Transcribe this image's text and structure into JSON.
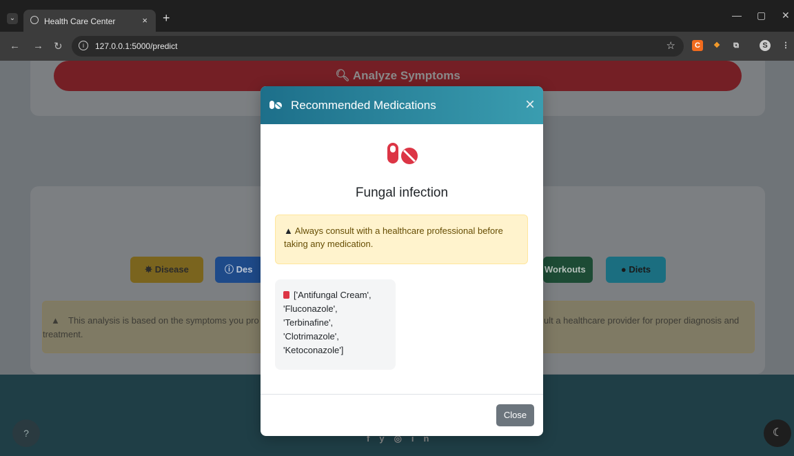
{
  "browser": {
    "tab_title": "Health Care Center",
    "tab_close": "×",
    "new_tab": "+",
    "url": "127.0.0.1:5000/predict",
    "minimize": "—",
    "maximize": "▢",
    "close": "✕"
  },
  "page": {
    "analyze_label": "Analyze Symptoms",
    "result_buttons": [
      "Disease",
      "Des",
      "Workouts",
      "Diets"
    ],
    "disclaimer_left": "This analysis is based on the symptoms you pro",
    "disclaimer_right": "ult a healthcare provider for proper diagnosis and",
    "disclaimer_line2": "treatment.",
    "help_label": "?",
    "social_icons": [
      "facebook-icon",
      "twitter-icon",
      "instagram-icon",
      "linkedin-icon"
    ],
    "colors": {
      "analyze": "#dc3545",
      "disease_btn": "#ffc107",
      "desc_btn": "#0d6efd",
      "workouts_btn": "#198754",
      "diets_btn": "#0dcaf0"
    }
  },
  "modal": {
    "title": "Recommended Medications",
    "close_icon": "×",
    "disease_name": "Fungal infection",
    "warning": "Always consult with a healthcare professional before taking any medication.",
    "medications_lines": [
      "['Antifungal Cream',",
      "'Fluconazole',",
      "'Terbinafine',",
      "'Clotrimazole',",
      "'Ketoconazole']"
    ],
    "close_button": "Close"
  }
}
